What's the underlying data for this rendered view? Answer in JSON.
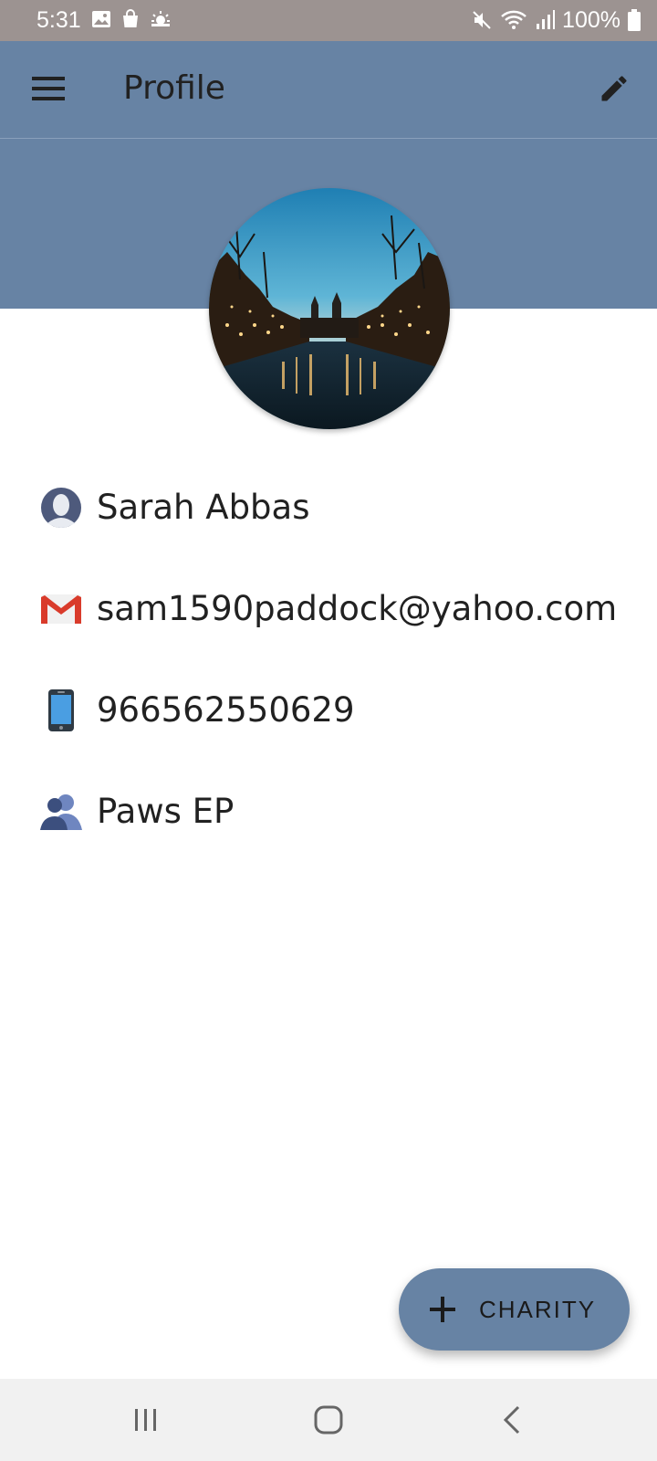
{
  "status_bar": {
    "time": "5:31",
    "battery_text": "100%",
    "left_icons": [
      "image-icon",
      "shopping-bag-icon",
      "weather-icon"
    ],
    "right_icons": [
      "mute-icon",
      "wifi-icon",
      "signal-icon",
      "battery-icon"
    ]
  },
  "app_bar": {
    "title": "Profile",
    "menu_icon": "menu-icon",
    "edit_icon": "edit-icon",
    "color": "#6783a4"
  },
  "profile": {
    "avatar": "profile-photo-canal-night",
    "name": "Sarah Abbas",
    "email": "sam1590paddock@yahoo.com",
    "phone": "966562550629",
    "organization": "Paws EP"
  },
  "fab": {
    "label": "CHARITY",
    "icon": "plus-icon"
  },
  "nav_bar": {
    "buttons": [
      "recent-apps-icon",
      "home-icon",
      "back-icon"
    ]
  }
}
